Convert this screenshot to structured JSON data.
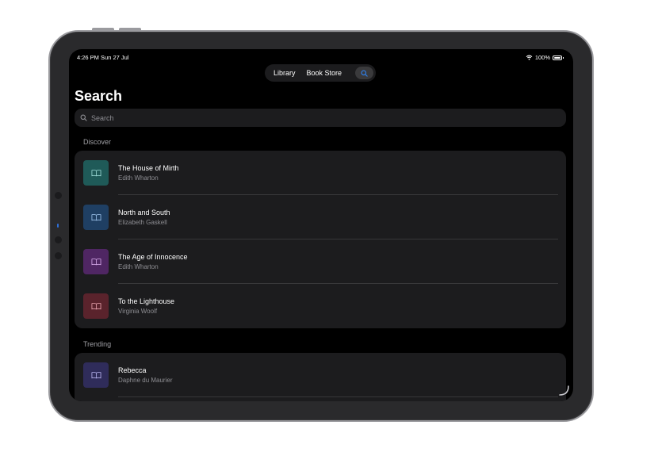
{
  "status": {
    "time": "4:26 PM  Sun 27 Jul",
    "battery": "100%"
  },
  "nav": {
    "library_label": "Library",
    "bookstore_label": "Book Store"
  },
  "page": {
    "title": "Search"
  },
  "search": {
    "placeholder": "Search"
  },
  "sections": {
    "discover": {
      "label": "Discover",
      "items": [
        {
          "title": "The House of Mirth",
          "author": "Edith Wharton",
          "color": "#1f5a58"
        },
        {
          "title": "North and South",
          "author": "Elizabeth Gaskell",
          "color": "#1f3f63"
        },
        {
          "title": "The Age of Innocence",
          "author": "Edith Wharton",
          "color": "#4f2663"
        },
        {
          "title": "To the Lighthouse",
          "author": "Virginia Woolf",
          "color": "#5a232c"
        }
      ]
    },
    "trending": {
      "label": "Trending",
      "items": [
        {
          "title": "Rebecca",
          "author": "Daphne du Maurier",
          "color": "#2f2c5a"
        }
      ]
    }
  },
  "colors": {
    "accent": "#2f7fe8",
    "screen_bg": "#000000",
    "card_bg": "#1c1c1e"
  },
  "icons": {
    "book": "book-icon",
    "search": "search-icon",
    "wifi": "wifi-icon",
    "battery": "battery-icon"
  }
}
